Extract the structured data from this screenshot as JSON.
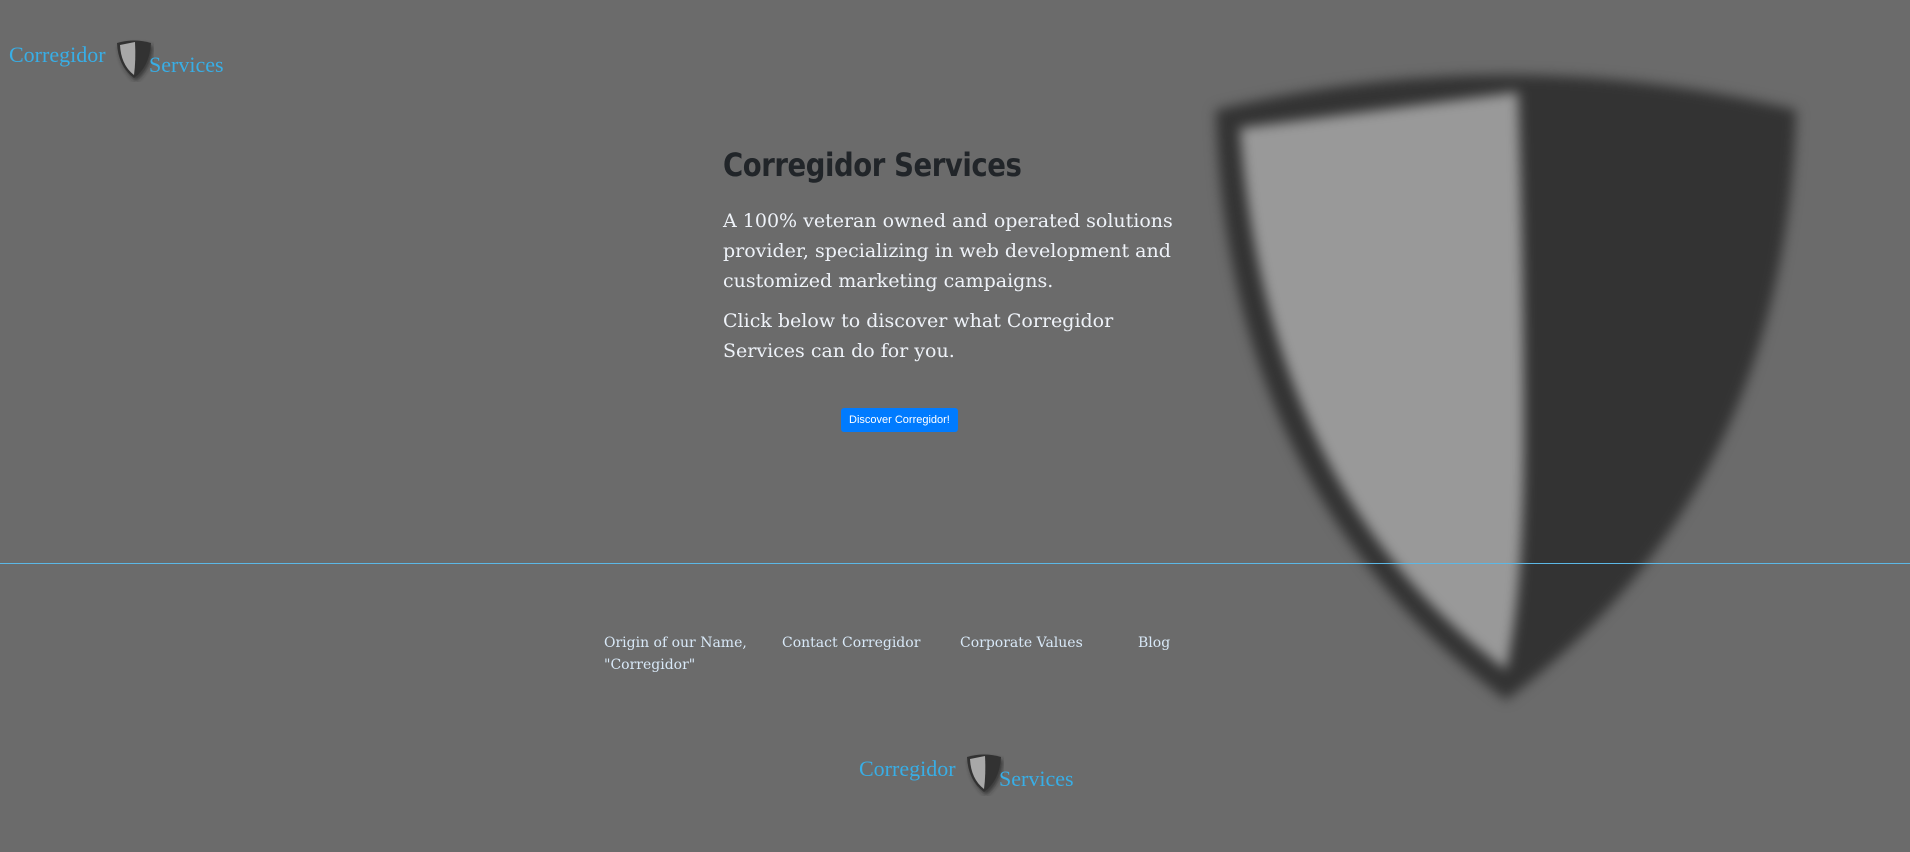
{
  "brand": {
    "word1": "Corregidor",
    "word2": "Services",
    "color": "#38aee6"
  },
  "hero": {
    "title": "Corregidor Services",
    "paragraph1": "A 100% veteran owned and operated solutions provider, specializing in web development and customized marketing campaigns.",
    "paragraph2": "Click below to discover what Corregidor Services can do for you.",
    "button_label": "Discover Corregidor!",
    "button_color": "#007bff"
  },
  "footer": {
    "links": [
      {
        "label": "Origin of our Name, \"Corregidor\""
      },
      {
        "label": "Contact Corregidor"
      },
      {
        "label": "Corporate Values"
      },
      {
        "label": "Blog"
      }
    ]
  },
  "icons": {
    "logo_icon": "shield-icon",
    "hero_icon": "shield-icon"
  }
}
